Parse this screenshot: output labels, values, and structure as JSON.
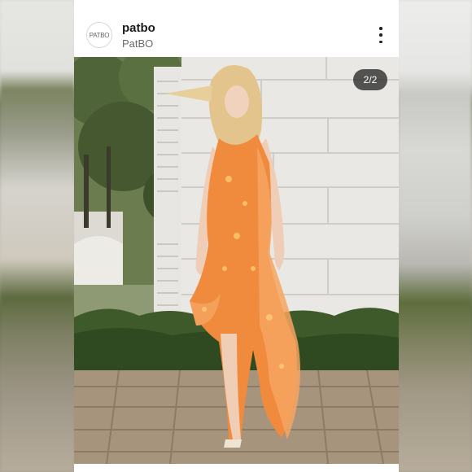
{
  "post": {
    "username": "patbo",
    "display_name": "PatBO",
    "avatar_text": "PATBO",
    "image_counter": "2/2",
    "colors": {
      "dress": "#f08a3c",
      "accent": "#222222"
    }
  },
  "icons": {
    "more": "more-vertical-icon"
  }
}
